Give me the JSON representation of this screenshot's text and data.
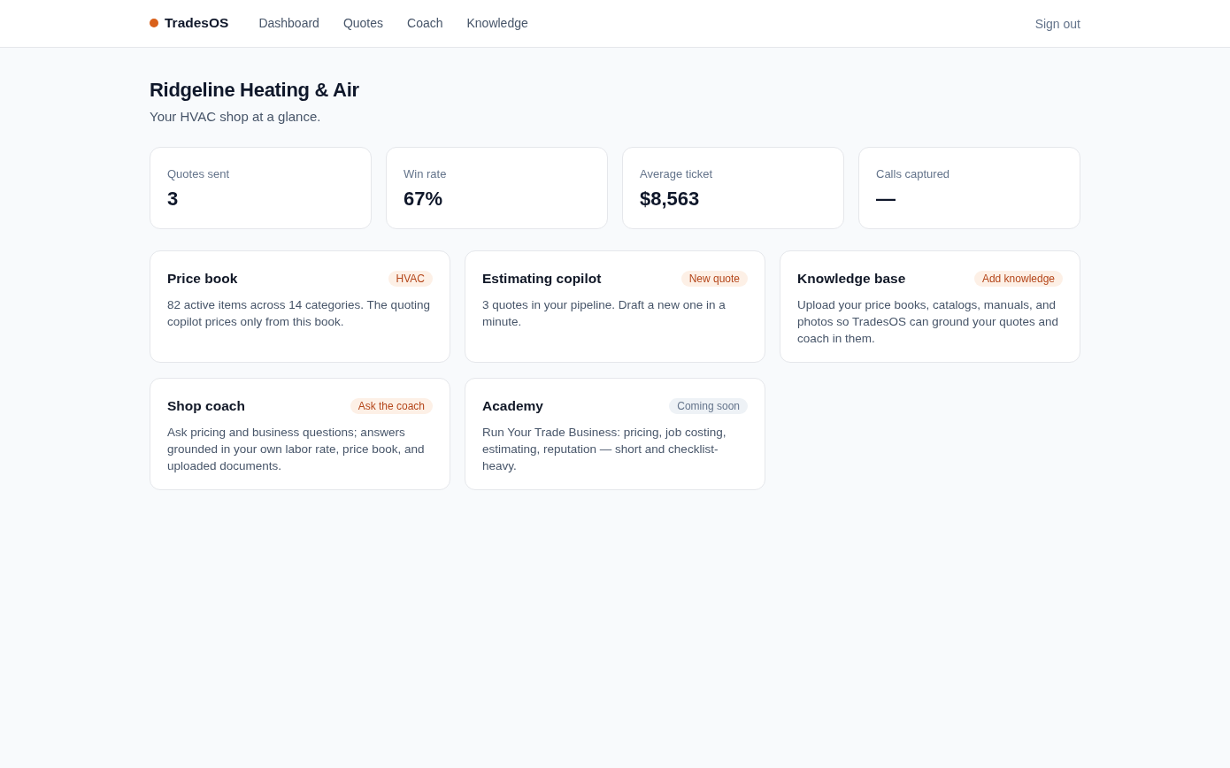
{
  "header": {
    "brand": "TradesOS",
    "nav": [
      {
        "label": "Dashboard",
        "selected": false
      },
      {
        "label": "Quotes",
        "selected": false
      },
      {
        "label": "Coach",
        "selected": false
      },
      {
        "label": "Knowledge",
        "selected": false
      }
    ],
    "sign_out": "Sign out"
  },
  "page": {
    "title": "Ridgeline Heating & Air",
    "subtitle": "Your HVAC shop at a glance."
  },
  "stats": [
    {
      "label": "Quotes sent",
      "value": "3"
    },
    {
      "label": "Win rate",
      "value": "67%"
    },
    {
      "label": "Average ticket",
      "value": "$8,563"
    },
    {
      "label": "Calls captured",
      "value": "—"
    }
  ],
  "features": [
    {
      "title": "Price book",
      "badge": {
        "text": "HVAC",
        "kind": "accent"
      },
      "description": "82 active items across 14 categories. The quoting copilot prices only from this book."
    },
    {
      "title": "Estimating copilot",
      "badge": {
        "text": "New quote",
        "kind": "accent"
      },
      "description": "3 quotes in your pipeline. Draft a new one in a minute."
    },
    {
      "title": "Knowledge base",
      "badge": {
        "text": "Add knowledge",
        "kind": "accent"
      },
      "description": "Upload your price books, catalogs, manuals, and photos so TradesOS can ground your quotes and coach in them."
    },
    {
      "title": "Shop coach",
      "badge": {
        "text": "Ask the coach",
        "kind": "accent"
      },
      "description": "Ask pricing and business questions; answers grounded in your own labor rate, price book, and uploaded documents."
    },
    {
      "title": "Academy",
      "badge": {
        "text": "Coming soon",
        "kind": "muted"
      },
      "description": "Run Your Trade Business: pricing, job costing, estimating, reputation — short and checklist-heavy."
    }
  ]
}
